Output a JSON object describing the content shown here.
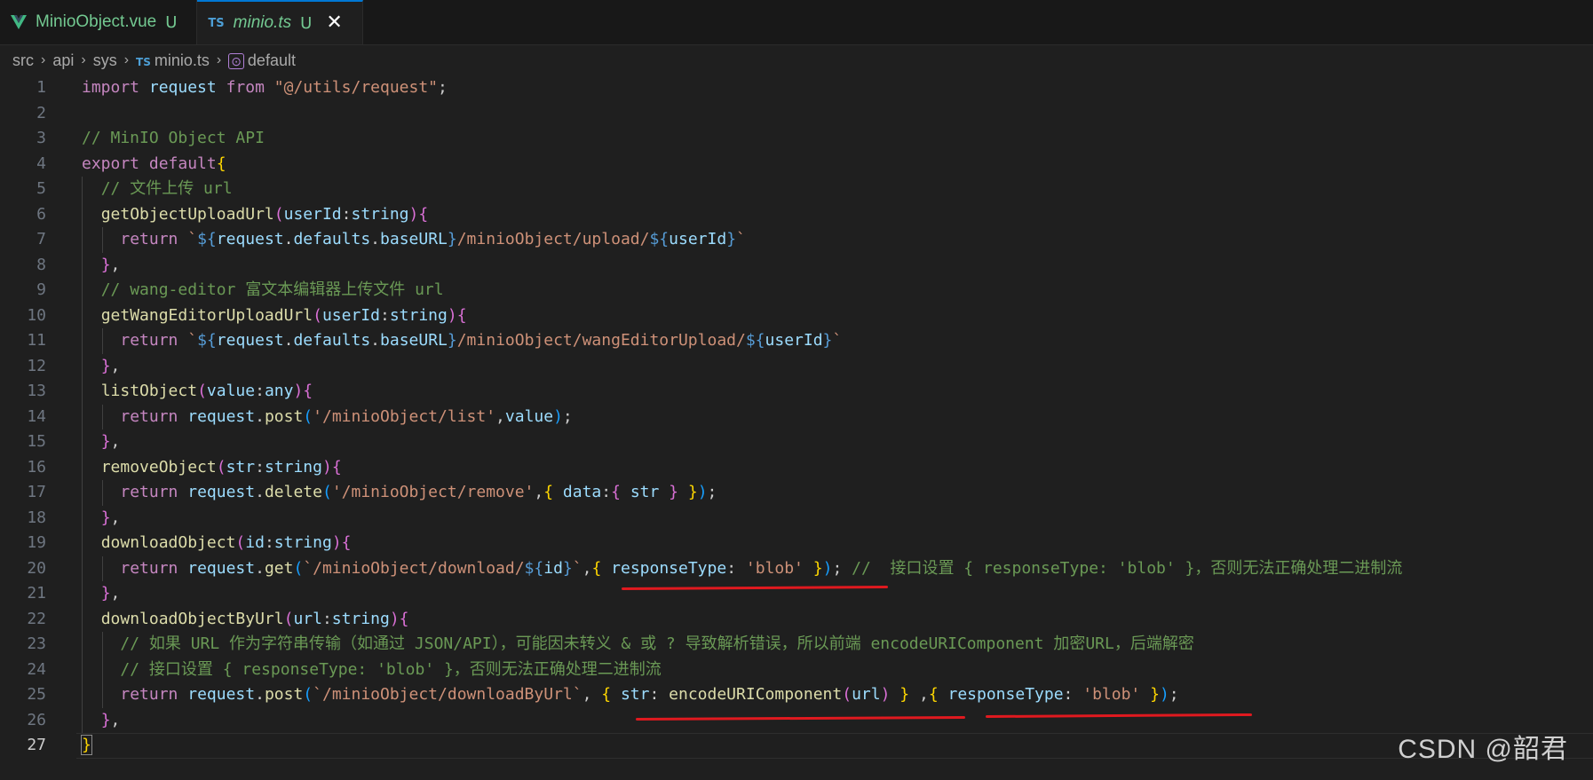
{
  "tabs": [
    {
      "name": "MinioObject.vue",
      "status": "U",
      "icon": "vue-icon"
    },
    {
      "name": "minio.ts",
      "status": "U",
      "icon": "ts-icon",
      "active": true
    }
  ],
  "ts_badge": "TS",
  "breadcrumb": [
    "src",
    "api",
    "sys",
    "minio.ts",
    "default"
  ],
  "watermark": "CSDN @韶君",
  "lines": [
    {
      "n": "1",
      "parts": [
        [
          "kw",
          "import"
        ],
        [
          "pl",
          " "
        ],
        [
          "var",
          "request"
        ],
        [
          "pl",
          " "
        ],
        [
          "kw",
          "from"
        ],
        [
          "pl",
          " "
        ],
        [
          "str",
          "\"@/utils/request\""
        ],
        [
          "pl",
          ";"
        ]
      ]
    },
    {
      "n": "2",
      "parts": []
    },
    {
      "n": "3",
      "parts": [
        [
          "cm",
          "// MinIO Object API"
        ]
      ]
    },
    {
      "n": "4",
      "parts": [
        [
          "kw",
          "export"
        ],
        [
          "pl",
          " "
        ],
        [
          "kw",
          "default"
        ],
        [
          "b1",
          "{"
        ]
      ]
    },
    {
      "n": "5",
      "parts": [
        [
          "pl",
          "  "
        ],
        [
          "cm",
          "// 文件上传 url"
        ]
      ]
    },
    {
      "n": "6",
      "parts": [
        [
          "pl",
          "  "
        ],
        [
          "fn",
          "getObjectUploadUrl"
        ],
        [
          "b2",
          "("
        ],
        [
          "var",
          "userId"
        ],
        [
          "pl",
          ":"
        ],
        [
          "var",
          "string"
        ],
        [
          "b2",
          ")"
        ],
        [
          "b2",
          "{"
        ]
      ]
    },
    {
      "n": "7",
      "parts": [
        [
          "pl",
          "    "
        ],
        [
          "kw",
          "return"
        ],
        [
          "pl",
          " "
        ],
        [
          "str",
          "`"
        ],
        [
          "kwb",
          "${"
        ],
        [
          "var",
          "request"
        ],
        [
          "pl",
          "."
        ],
        [
          "var",
          "defaults"
        ],
        [
          "pl",
          "."
        ],
        [
          "var",
          "baseURL"
        ],
        [
          "kwb",
          "}"
        ],
        [
          "str",
          "/minioObject/upload/"
        ],
        [
          "kwb",
          "${"
        ],
        [
          "var",
          "userId"
        ],
        [
          "kwb",
          "}"
        ],
        [
          "str",
          "`"
        ]
      ]
    },
    {
      "n": "8",
      "parts": [
        [
          "pl",
          "  "
        ],
        [
          "b2",
          "}"
        ],
        [
          "pl",
          ","
        ]
      ]
    },
    {
      "n": "9",
      "parts": [
        [
          "pl",
          "  "
        ],
        [
          "cm",
          "// wang-editor 富文本编辑器上传文件 url"
        ]
      ]
    },
    {
      "n": "10",
      "parts": [
        [
          "pl",
          "  "
        ],
        [
          "fn",
          "getWangEditorUploadUrl"
        ],
        [
          "b2",
          "("
        ],
        [
          "var",
          "userId"
        ],
        [
          "pl",
          ":"
        ],
        [
          "var",
          "string"
        ],
        [
          "b2",
          ")"
        ],
        [
          "b2",
          "{"
        ]
      ]
    },
    {
      "n": "11",
      "parts": [
        [
          "pl",
          "    "
        ],
        [
          "kw",
          "return"
        ],
        [
          "pl",
          " "
        ],
        [
          "str",
          "`"
        ],
        [
          "kwb",
          "${"
        ],
        [
          "var",
          "request"
        ],
        [
          "pl",
          "."
        ],
        [
          "var",
          "defaults"
        ],
        [
          "pl",
          "."
        ],
        [
          "var",
          "baseURL"
        ],
        [
          "kwb",
          "}"
        ],
        [
          "str",
          "/minioObject/wangEditorUpload/"
        ],
        [
          "kwb",
          "${"
        ],
        [
          "var",
          "userId"
        ],
        [
          "kwb",
          "}"
        ],
        [
          "str",
          "`"
        ]
      ]
    },
    {
      "n": "12",
      "parts": [
        [
          "pl",
          "  "
        ],
        [
          "b2",
          "}"
        ],
        [
          "pl",
          ","
        ]
      ]
    },
    {
      "n": "13",
      "parts": [
        [
          "pl",
          "  "
        ],
        [
          "fn",
          "listObject"
        ],
        [
          "b2",
          "("
        ],
        [
          "var",
          "value"
        ],
        [
          "pl",
          ":"
        ],
        [
          "var",
          "any"
        ],
        [
          "b2",
          ")"
        ],
        [
          "b2",
          "{"
        ]
      ]
    },
    {
      "n": "14",
      "parts": [
        [
          "pl",
          "    "
        ],
        [
          "kw",
          "return"
        ],
        [
          "pl",
          " "
        ],
        [
          "var",
          "request"
        ],
        [
          "pl",
          "."
        ],
        [
          "fn",
          "post"
        ],
        [
          "b3",
          "("
        ],
        [
          "str",
          "'/minioObject/list'"
        ],
        [
          "pl",
          ","
        ],
        [
          "var",
          "value"
        ],
        [
          "b3",
          ")"
        ],
        [
          "pl",
          ";"
        ]
      ]
    },
    {
      "n": "15",
      "parts": [
        [
          "pl",
          "  "
        ],
        [
          "b2",
          "}"
        ],
        [
          "pl",
          ","
        ]
      ]
    },
    {
      "n": "16",
      "parts": [
        [
          "pl",
          "  "
        ],
        [
          "fn",
          "removeObject"
        ],
        [
          "b2",
          "("
        ],
        [
          "var",
          "str"
        ],
        [
          "pl",
          ":"
        ],
        [
          "var",
          "string"
        ],
        [
          "b2",
          ")"
        ],
        [
          "b2",
          "{"
        ]
      ]
    },
    {
      "n": "17",
      "parts": [
        [
          "pl",
          "    "
        ],
        [
          "kw",
          "return"
        ],
        [
          "pl",
          " "
        ],
        [
          "var",
          "request"
        ],
        [
          "pl",
          "."
        ],
        [
          "fn",
          "delete"
        ],
        [
          "b3",
          "("
        ],
        [
          "str",
          "'/minioObject/remove'"
        ],
        [
          "pl",
          ","
        ],
        [
          "b1",
          "{"
        ],
        [
          "pl",
          " "
        ],
        [
          "var",
          "data"
        ],
        [
          "pl",
          ":"
        ],
        [
          "b2",
          "{"
        ],
        [
          "pl",
          " "
        ],
        [
          "var",
          "str"
        ],
        [
          "pl",
          " "
        ],
        [
          "b2",
          "}"
        ],
        [
          "pl",
          " "
        ],
        [
          "b1",
          "}"
        ],
        [
          "b3",
          ")"
        ],
        [
          "pl",
          ";"
        ]
      ]
    },
    {
      "n": "18",
      "parts": [
        [
          "pl",
          "  "
        ],
        [
          "b2",
          "}"
        ],
        [
          "pl",
          ","
        ]
      ]
    },
    {
      "n": "19",
      "parts": [
        [
          "pl",
          "  "
        ],
        [
          "fn",
          "downloadObject"
        ],
        [
          "b2",
          "("
        ],
        [
          "var",
          "id"
        ],
        [
          "pl",
          ":"
        ],
        [
          "var",
          "string"
        ],
        [
          "b2",
          ")"
        ],
        [
          "b2",
          "{"
        ]
      ]
    },
    {
      "n": "20",
      "parts": [
        [
          "pl",
          "    "
        ],
        [
          "kw",
          "return"
        ],
        [
          "pl",
          " "
        ],
        [
          "var",
          "request"
        ],
        [
          "pl",
          "."
        ],
        [
          "fn",
          "get"
        ],
        [
          "b3",
          "("
        ],
        [
          "str",
          "`/minioObject/download/"
        ],
        [
          "kwb",
          "${"
        ],
        [
          "var",
          "id"
        ],
        [
          "kwb",
          "}"
        ],
        [
          "str",
          "`"
        ],
        [
          "pl",
          ","
        ],
        [
          "b1",
          "{"
        ],
        [
          "pl",
          " "
        ],
        [
          "var",
          "responseType"
        ],
        [
          "pl",
          ": "
        ],
        [
          "str",
          "'blob'"
        ],
        [
          "pl",
          " "
        ],
        [
          "b1",
          "}"
        ],
        [
          "b3",
          ")"
        ],
        [
          "pl",
          "; "
        ],
        [
          "cm",
          "//  接口设置 { responseType: 'blob' }，否则无法正确处理二进制流"
        ]
      ]
    },
    {
      "n": "21",
      "parts": [
        [
          "pl",
          "  "
        ],
        [
          "b2",
          "}"
        ],
        [
          "pl",
          ","
        ]
      ]
    },
    {
      "n": "22",
      "parts": [
        [
          "pl",
          "  "
        ],
        [
          "fn",
          "downloadObjectByUrl"
        ],
        [
          "b2",
          "("
        ],
        [
          "var",
          "url"
        ],
        [
          "pl",
          ":"
        ],
        [
          "var",
          "string"
        ],
        [
          "b2",
          ")"
        ],
        [
          "b2",
          "{"
        ]
      ]
    },
    {
      "n": "23",
      "parts": [
        [
          "pl",
          "    "
        ],
        [
          "cm",
          "// 如果 URL 作为字符串传输（如通过 JSON/API），可能因未转义 & 或 ? 导致解析错误，所以前端 encodeURIComponent 加密URL，后端解密"
        ]
      ]
    },
    {
      "n": "24",
      "parts": [
        [
          "pl",
          "    "
        ],
        [
          "cm",
          "// 接口设置 { responseType: 'blob' }，否则无法正确处理二进制流"
        ]
      ]
    },
    {
      "n": "25",
      "parts": [
        [
          "pl",
          "    "
        ],
        [
          "kw",
          "return"
        ],
        [
          "pl",
          " "
        ],
        [
          "var",
          "request"
        ],
        [
          "pl",
          "."
        ],
        [
          "fn",
          "post"
        ],
        [
          "b3",
          "("
        ],
        [
          "str",
          "`/minioObject/downloadByUrl`"
        ],
        [
          "pl",
          ", "
        ],
        [
          "b1",
          "{"
        ],
        [
          "pl",
          " "
        ],
        [
          "var",
          "str"
        ],
        [
          "pl",
          ": "
        ],
        [
          "fn",
          "encodeURIComponent"
        ],
        [
          "b2",
          "("
        ],
        [
          "var",
          "url"
        ],
        [
          "b2",
          ")"
        ],
        [
          "pl",
          " "
        ],
        [
          "b1",
          "}"
        ],
        [
          "pl",
          " ,"
        ],
        [
          "b1",
          "{"
        ],
        [
          "pl",
          " "
        ],
        [
          "var",
          "responseType"
        ],
        [
          "pl",
          ": "
        ],
        [
          "str",
          "'blob'"
        ],
        [
          "pl",
          " "
        ],
        [
          "b1",
          "}"
        ],
        [
          "b3",
          ")"
        ],
        [
          "pl",
          ";"
        ]
      ]
    },
    {
      "n": "26",
      "parts": [
        [
          "pl",
          "  "
        ],
        [
          "b2",
          "}"
        ],
        [
          "pl",
          ","
        ]
      ]
    },
    {
      "n": "27",
      "parts": [
        [
          "b1",
          "}"
        ]
      ]
    }
  ]
}
